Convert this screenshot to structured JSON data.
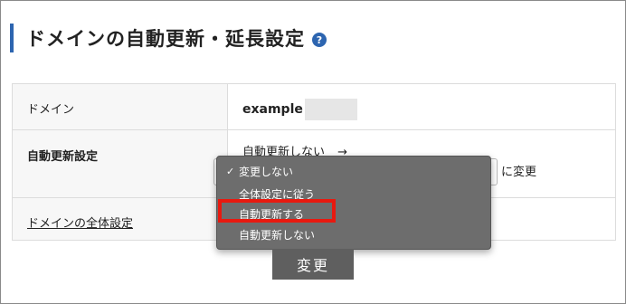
{
  "page": {
    "title": "ドメインの自動更新・延長設定",
    "help_icon": "?"
  },
  "table": {
    "rows": [
      {
        "label": "ドメイン",
        "value": "example"
      },
      {
        "label": "自動更新設定",
        "current": "自動更新しない",
        "arrow": "→",
        "after_select": "に変更"
      },
      {
        "label": "ドメインの全体設定"
      }
    ]
  },
  "dropdown": {
    "options": [
      {
        "label": "変更しない",
        "checked": true
      },
      {
        "label": "全体設定に従う",
        "checked": false
      },
      {
        "label": "自動更新する",
        "checked": false,
        "highlighted": true
      },
      {
        "label": "自動更新しない",
        "checked": false
      }
    ],
    "check_mark": "✓"
  },
  "actions": {
    "submit_label": "変更"
  },
  "colors": {
    "accent": "#2d65b0",
    "highlight": "#e8190f",
    "dropdown_bg": "#6d6d6d",
    "button_bg": "#5f5f5f"
  }
}
